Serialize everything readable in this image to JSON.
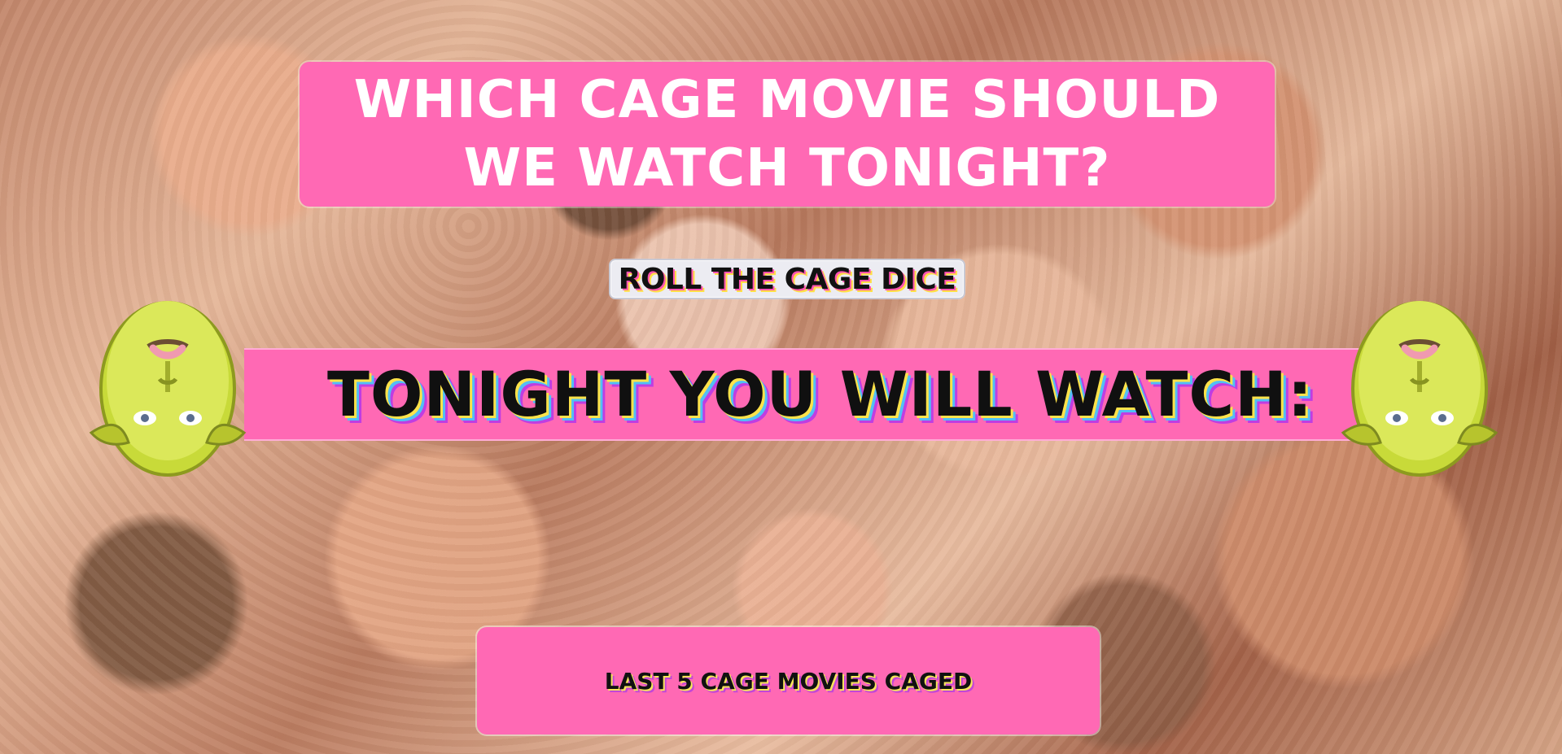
{
  "header": {
    "title_line_1": "WHICH CAGE MOVIE SHOULD",
    "title_line_2": "WE WATCH TONIGHT?"
  },
  "actions": {
    "roll_button": "ROLL THE CAGE DICE"
  },
  "result": {
    "label": "TONIGHT YOU WILL WATCH:"
  },
  "history": {
    "label": "LAST 5 CAGE MOVIES CAGED"
  },
  "decor": {
    "background": "collage-of-faces",
    "side_icon": "shrek-face-icon",
    "accent": "#ff69b4"
  }
}
